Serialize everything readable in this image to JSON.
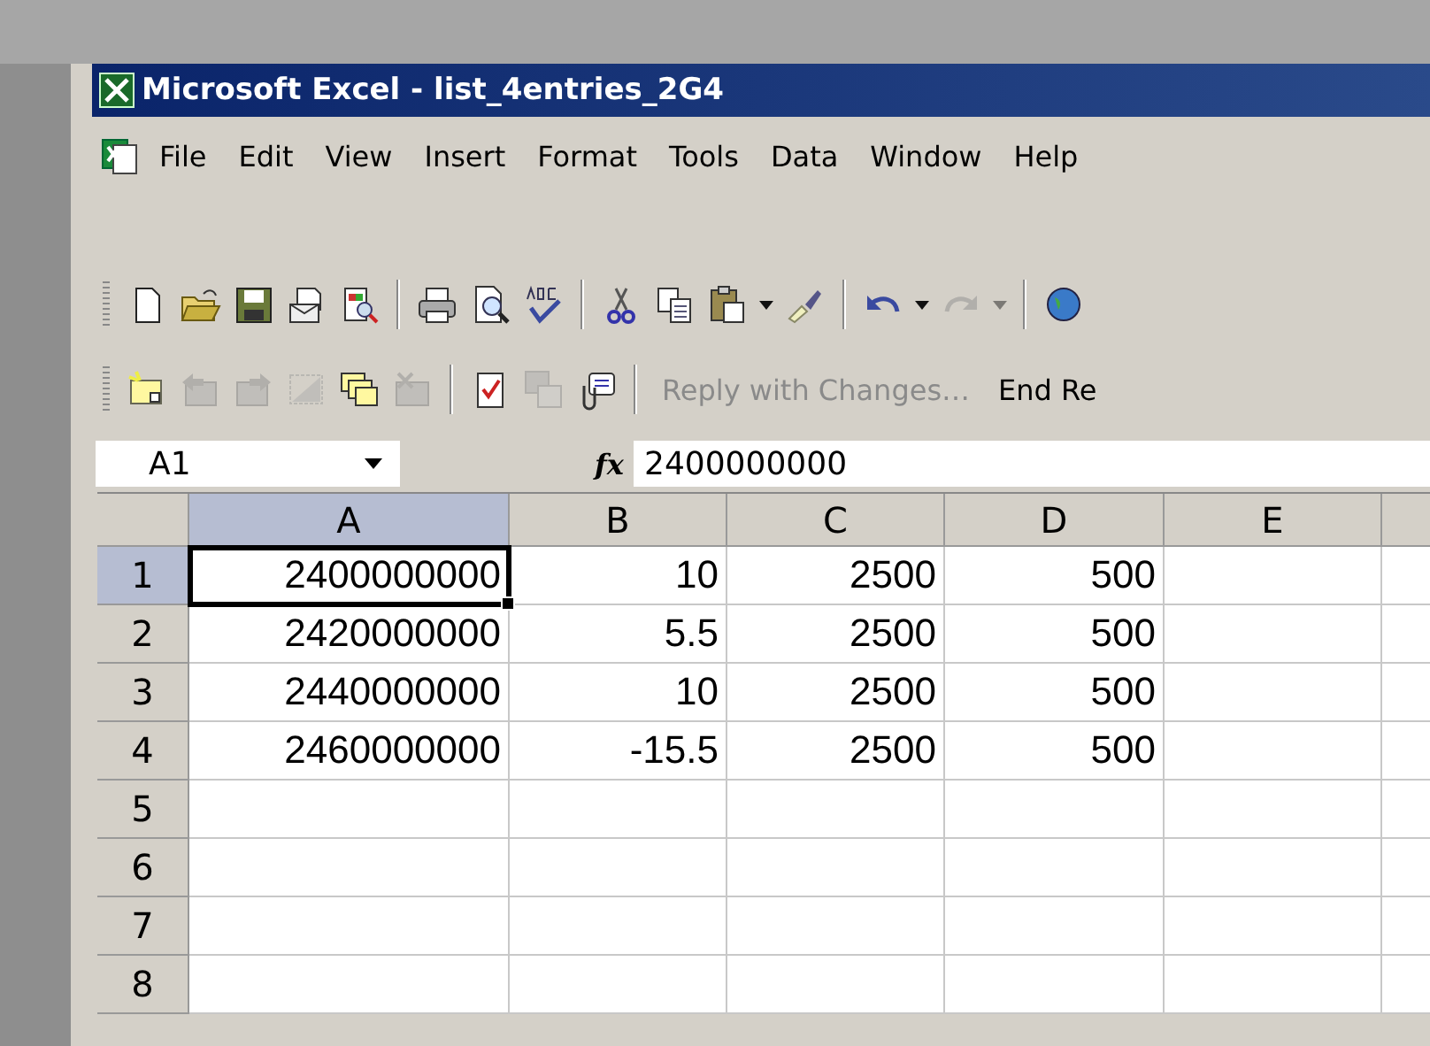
{
  "window": {
    "title": "Microsoft Excel - list_4entries_2G4"
  },
  "menu": [
    "File",
    "Edit",
    "View",
    "Insert",
    "Format",
    "Tools",
    "Data",
    "Window",
    "Help"
  ],
  "toolbars": [
    {
      "items": [
        {
          "kind": "new",
          "disabled": false
        },
        {
          "kind": "open",
          "disabled": false
        },
        {
          "kind": "save",
          "disabled": false
        },
        {
          "kind": "permission",
          "disabled": false
        },
        {
          "kind": "research",
          "disabled": false
        },
        {
          "kind": "separator"
        },
        {
          "kind": "print",
          "disabled": false
        },
        {
          "kind": "preview",
          "disabled": false
        },
        {
          "kind": "spelling",
          "disabled": false
        },
        {
          "kind": "separator"
        },
        {
          "kind": "cut",
          "disabled": false
        },
        {
          "kind": "copy",
          "disabled": false
        },
        {
          "kind": "paste",
          "disabled": false
        },
        {
          "kind": "dropdown",
          "disabled": false
        },
        {
          "kind": "brush",
          "disabled": false
        },
        {
          "kind": "separator"
        },
        {
          "kind": "undo",
          "disabled": false
        },
        {
          "kind": "dropdown",
          "disabled": false
        },
        {
          "kind": "redo",
          "disabled": true
        },
        {
          "kind": "dropdown",
          "disabled": true
        },
        {
          "kind": "separator"
        },
        {
          "kind": "globe",
          "disabled": false
        }
      ]
    },
    {
      "items": [
        {
          "kind": "new-comment",
          "disabled": false
        },
        {
          "kind": "prev-comment",
          "disabled": true
        },
        {
          "kind": "next-comment",
          "disabled": true
        },
        {
          "kind": "show-comment",
          "disabled": true
        },
        {
          "kind": "show-all",
          "disabled": false
        },
        {
          "kind": "delete-comment",
          "disabled": true
        },
        {
          "kind": "separator"
        },
        {
          "kind": "track",
          "disabled": false
        },
        {
          "kind": "protect",
          "disabled": true
        },
        {
          "kind": "send",
          "disabled": false
        },
        {
          "kind": "separator"
        },
        {
          "kind": "text",
          "label": "Reply with Changes…",
          "disabled": true
        },
        {
          "kind": "text",
          "label": "End Re",
          "disabled": false
        }
      ]
    }
  ],
  "formula_bar": {
    "name_box": "A1",
    "fx": "fx",
    "value": "2400000000"
  },
  "sheet": {
    "columns": [
      {
        "label": "A",
        "selected": true
      },
      {
        "label": "B",
        "selected": false
      },
      {
        "label": "C",
        "selected": false
      },
      {
        "label": "D",
        "selected": false
      },
      {
        "label": "E",
        "selected": false
      }
    ],
    "rows": [
      {
        "label": "1",
        "selected": true,
        "cells": [
          "2400000000",
          "10",
          "2500",
          "500",
          ""
        ]
      },
      {
        "label": "2",
        "selected": false,
        "cells": [
          "2420000000",
          "5.5",
          "2500",
          "500",
          ""
        ]
      },
      {
        "label": "3",
        "selected": false,
        "cells": [
          "2440000000",
          "10",
          "2500",
          "500",
          ""
        ]
      },
      {
        "label": "4",
        "selected": false,
        "cells": [
          "2460000000",
          "-15.5",
          "2500",
          "500",
          ""
        ]
      },
      {
        "label": "5",
        "selected": false,
        "cells": [
          "",
          "",
          "",
          "",
          ""
        ]
      },
      {
        "label": "6",
        "selected": false,
        "cells": [
          "",
          "",
          "",
          "",
          ""
        ]
      },
      {
        "label": "7",
        "selected": false,
        "cells": [
          "",
          "",
          "",
          "",
          ""
        ]
      },
      {
        "label": "8",
        "selected": false,
        "cells": [
          "",
          "",
          "",
          "",
          ""
        ]
      }
    ]
  }
}
